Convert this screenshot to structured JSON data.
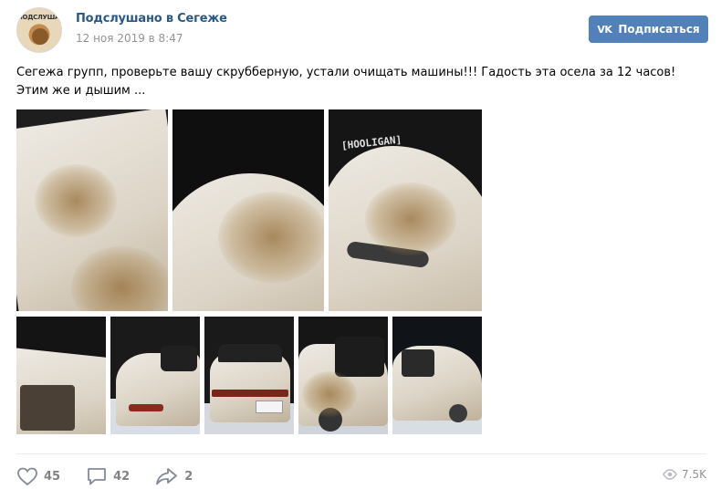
{
  "post": {
    "author": "Подслушано в Сегеже",
    "date": "12 ноя 2019 в 8:47",
    "avatar_text": "ПОДСЛУШАНО",
    "subscribe_label": "Подписаться",
    "vk_icon": "VK",
    "text": "Сегежа групп, проверьте вашу скрубберную, устали очищать машины!!! Гадость эта осела за 12 часов! Этим же и дышим ..."
  },
  "photos": {
    "plate_text": "[HOOLIGAN]"
  },
  "footer": {
    "likes": "45",
    "comments": "42",
    "shares": "2",
    "views": "7.5K"
  },
  "colors": {
    "link": "#2a5885",
    "button": "#5181b8",
    "muted": "#939393"
  },
  "icons": [
    "heart-icon",
    "comment-icon",
    "share-icon",
    "eye-icon",
    "vk-logo-icon"
  ]
}
